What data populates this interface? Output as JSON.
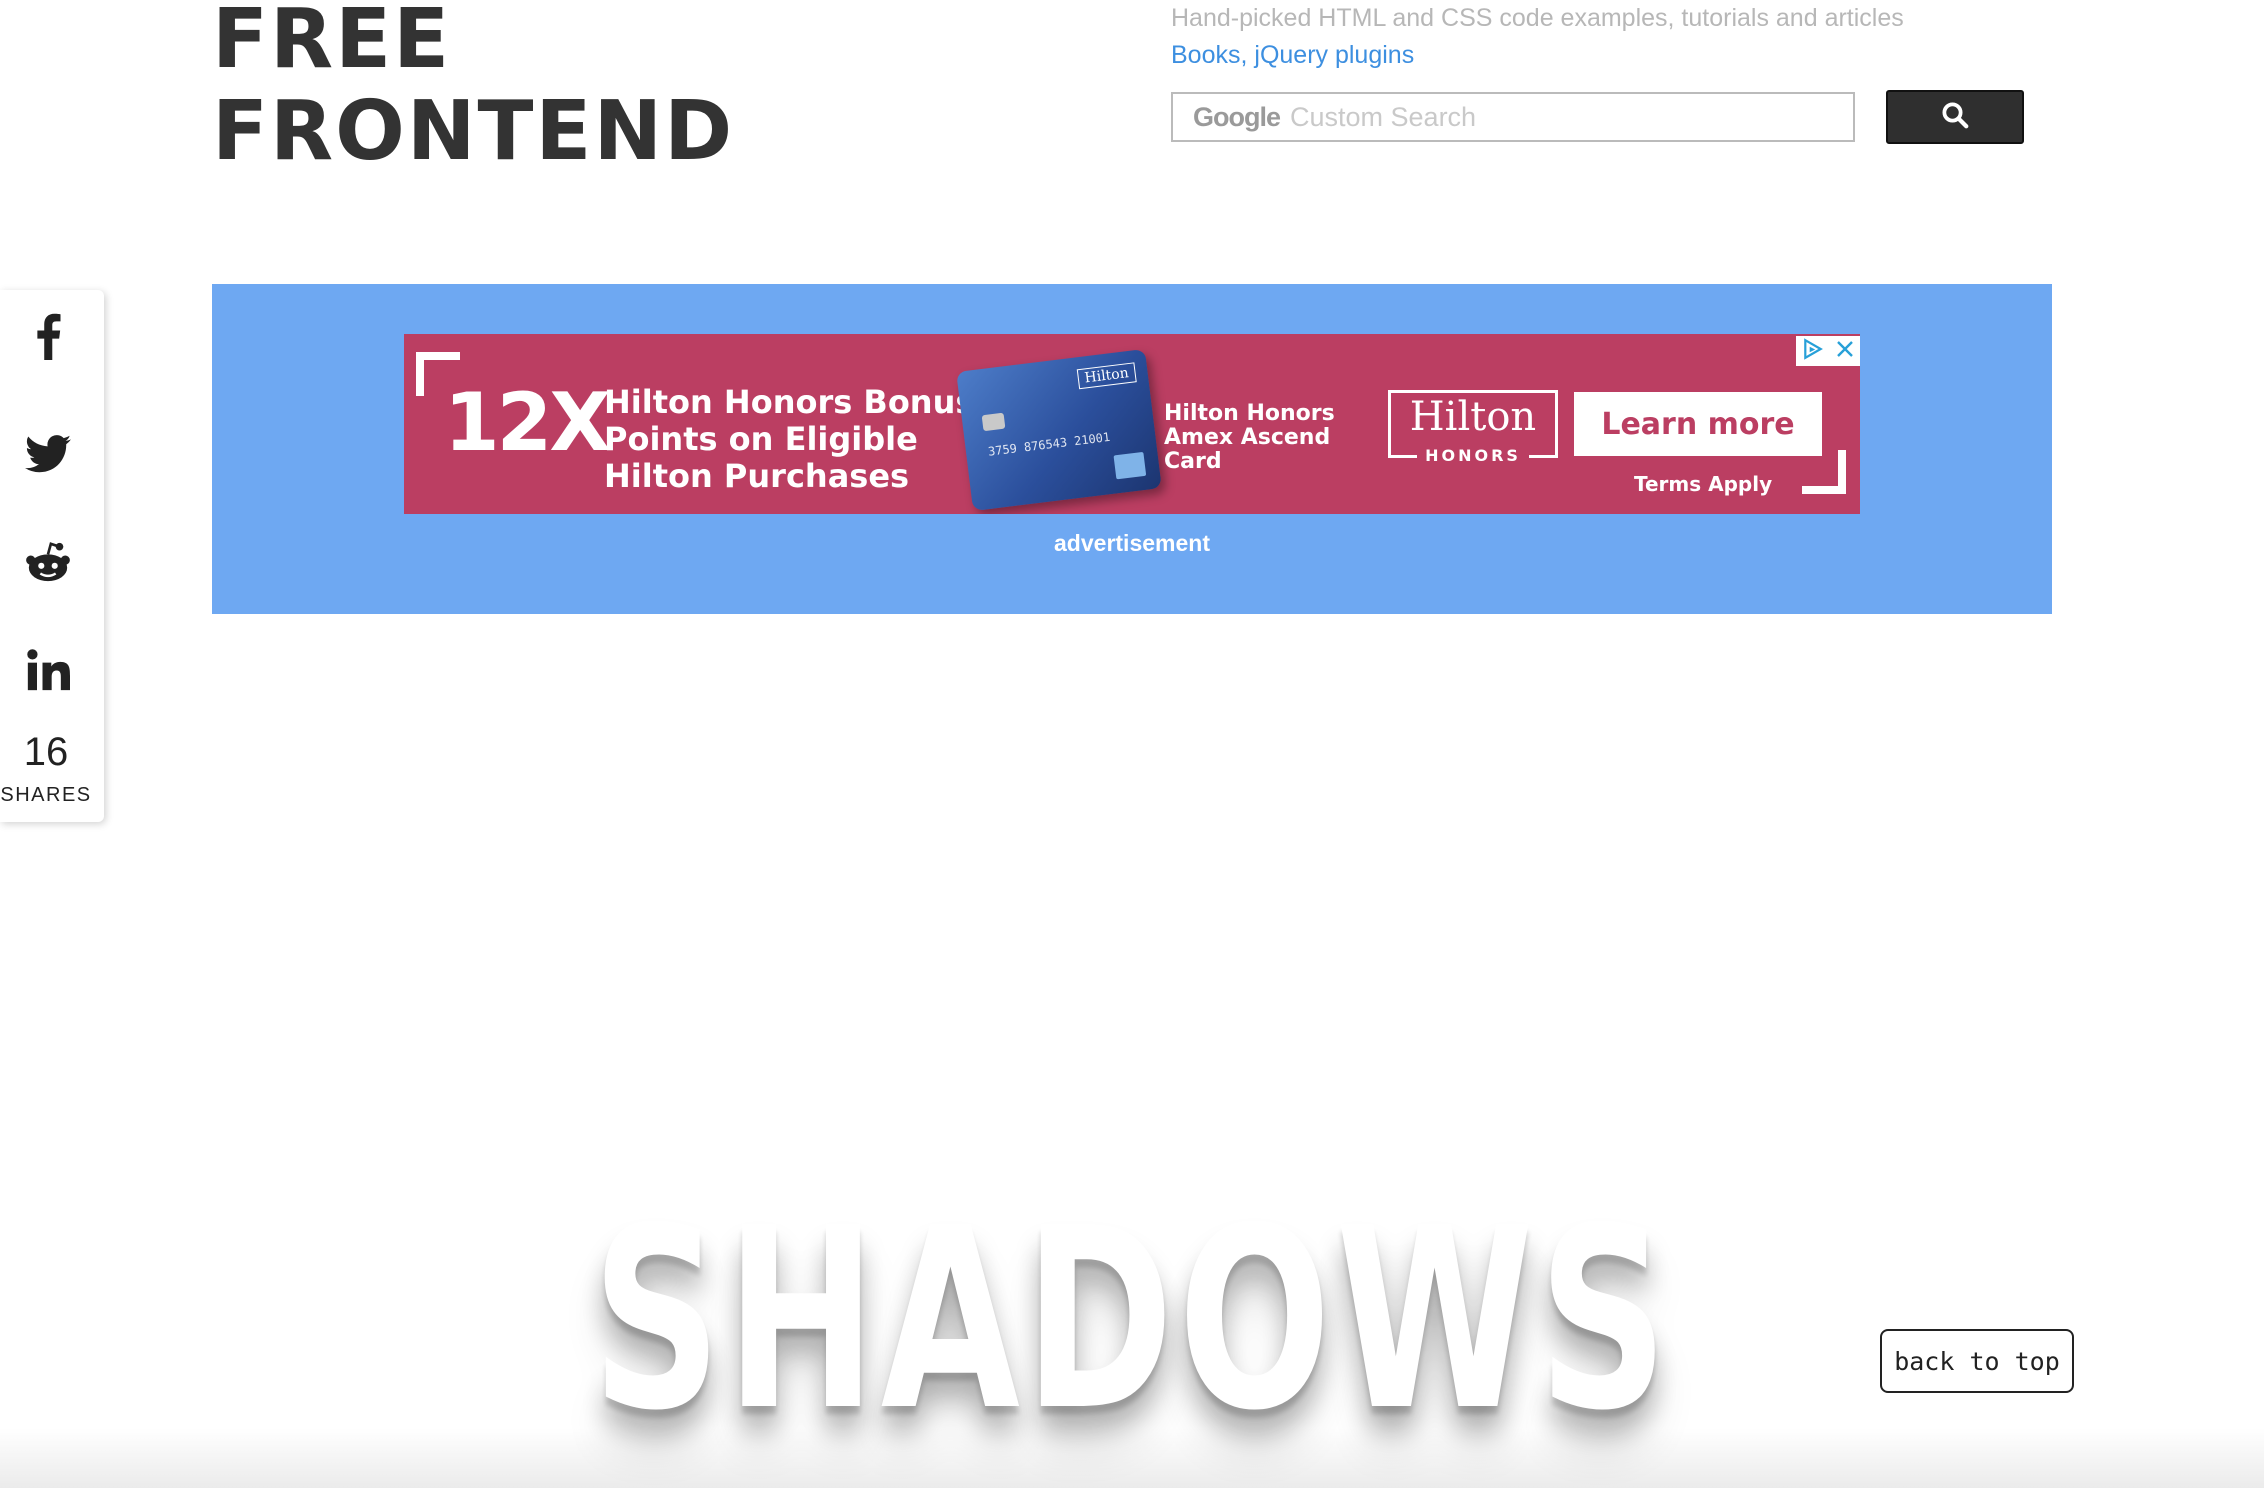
{
  "header": {
    "logo_line1": "FREE",
    "logo_line2": "FRONTEND",
    "tagline": "Hand-picked HTML and CSS code examples, tutorials and articles",
    "link_books": "Books,",
    "link_jquery": "jQuery plugins"
  },
  "search": {
    "brand": "Google",
    "placeholder": "Custom Search",
    "button_icon": "search-icon"
  },
  "share_bar": {
    "icons": [
      "facebook-icon",
      "twitter-icon",
      "reddit-icon",
      "linkedin-icon"
    ],
    "count": "16",
    "label": "SHARES"
  },
  "ad": {
    "multiplier": "12X",
    "headline_line1": "Hilton Honors Bonus",
    "headline_line2": "Points on Eligible",
    "headline_line3": "Hilton Purchases",
    "card_brand": "Hilton",
    "card_number": "3759 876543 21001",
    "product_line1": "Hilton Honors",
    "product_line2": "Amex Ascend",
    "product_line3": "Card",
    "logo_text": "Hilton",
    "logo_sub": "HONORS",
    "cta": "Learn more",
    "terms": "Terms Apply",
    "label": "advertisement"
  },
  "hero": {
    "title": "SHADOWS"
  },
  "back_to_top": "back to top",
  "colors": {
    "ad_panel": "#6ea8f2",
    "ad_banner": "#bb3e62",
    "link": "#3d8fe0",
    "logo": "#333333"
  }
}
